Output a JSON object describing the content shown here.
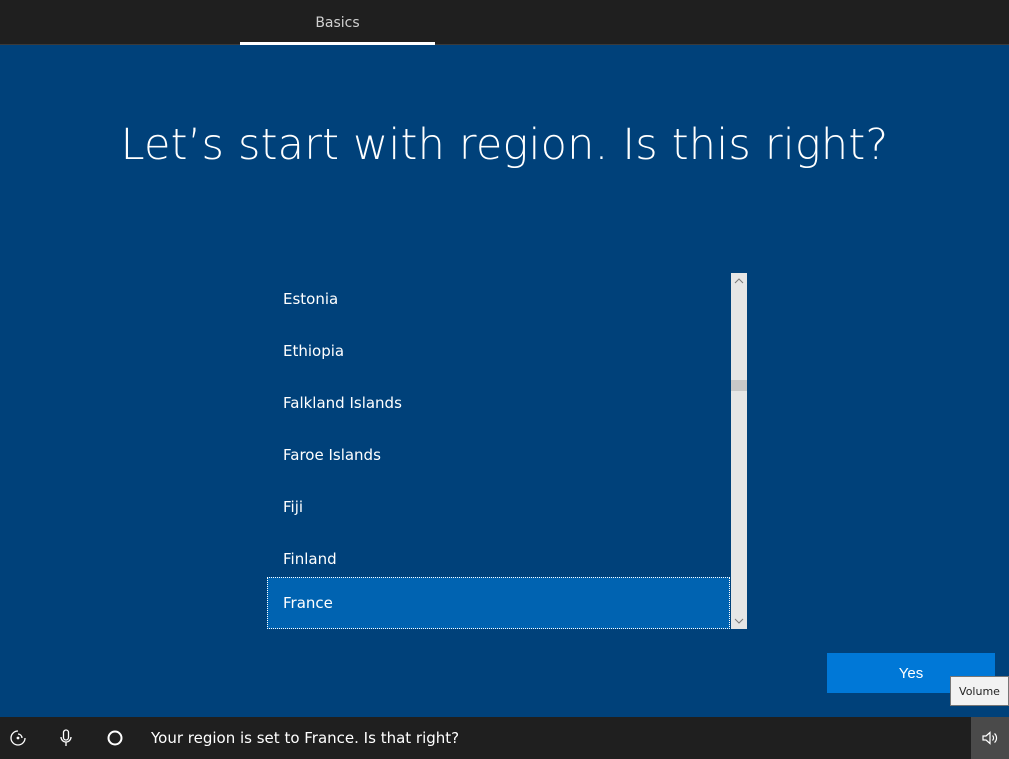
{
  "header": {
    "tab_label": "Basics"
  },
  "main": {
    "heading": "Let’s start with region. Is this right?",
    "regions": [
      "Estonia",
      "Ethiopia",
      "Falkland Islands",
      "Faroe Islands",
      "Fiji",
      "Finland",
      "France"
    ],
    "selected_region": "France",
    "yes_label": "Yes"
  },
  "footer": {
    "message": "Your region is set to France. Is that right?",
    "volume_tooltip": "Volume"
  },
  "icons": {
    "ease_of_access": "ease-of-access-icon",
    "microphone": "microphone-icon",
    "cortana": "cortana-icon",
    "volume": "volume-icon",
    "scroll_up": "chevron-up-icon",
    "scroll_down": "chevron-down-icon"
  },
  "colors": {
    "background": "#00417a",
    "selected": "#0063b1",
    "accent": "#0078d7",
    "bar": "#1f1f1f"
  }
}
